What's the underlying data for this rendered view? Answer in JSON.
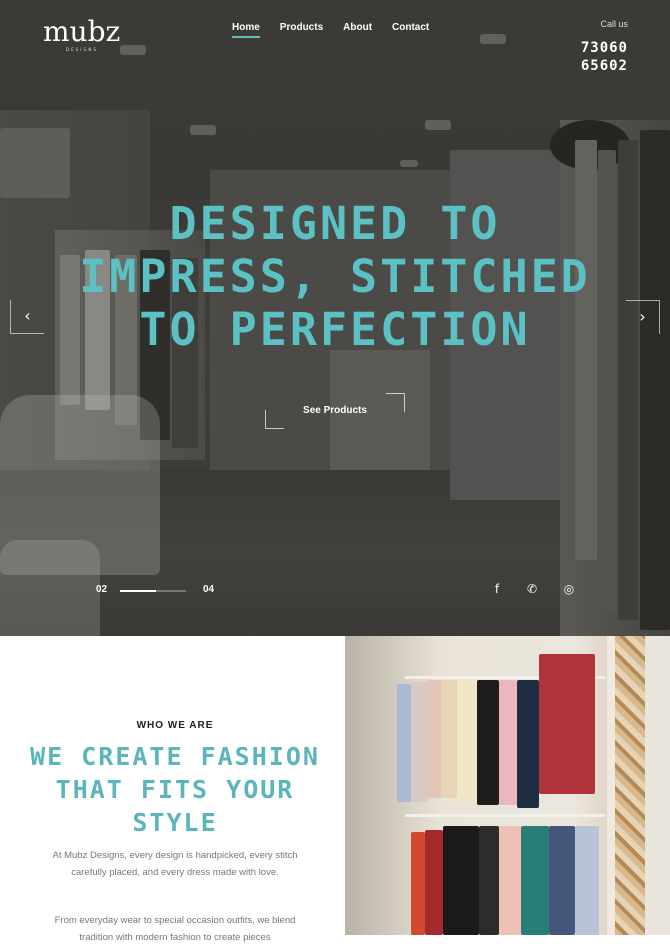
{
  "brand": {
    "name": "mubz",
    "tagline": "DESIGNS"
  },
  "nav": {
    "items": [
      {
        "label": "Home",
        "active": true
      },
      {
        "label": "Products",
        "active": false
      },
      {
        "label": "About",
        "active": false
      },
      {
        "label": "Contact",
        "active": false
      }
    ]
  },
  "contact": {
    "call_label": "Call us",
    "phone_line1": "73060",
    "phone_line2": "65602"
  },
  "hero": {
    "headline": "DESIGNED TO IMPRESS, STITCHED TO PERFECTION",
    "cta_label": "See Products",
    "prev_icon": "chevron-left-icon",
    "next_icon": "chevron-right-icon",
    "slide_current": "02",
    "slide_total": "04",
    "progress": 0.55,
    "accent_color": "#5cc1c4",
    "social": [
      {
        "icon": "facebook-icon",
        "glyph": "f"
      },
      {
        "icon": "whatsapp-icon",
        "glyph": "✆"
      },
      {
        "icon": "instagram-icon",
        "glyph": "◎"
      }
    ]
  },
  "about": {
    "eyebrow": "WHO WE ARE",
    "title": "WE CREATE FASHION THAT FITS YOUR STYLE",
    "paragraph1": "At Mubz Designs, every design is handpicked, every stitch carefully placed, and every dress made with love.",
    "paragraph2": "From everyday wear to special occasion outfits, we blend tradition with modern fashion to create pieces",
    "title_color": "#5cb5bb"
  }
}
